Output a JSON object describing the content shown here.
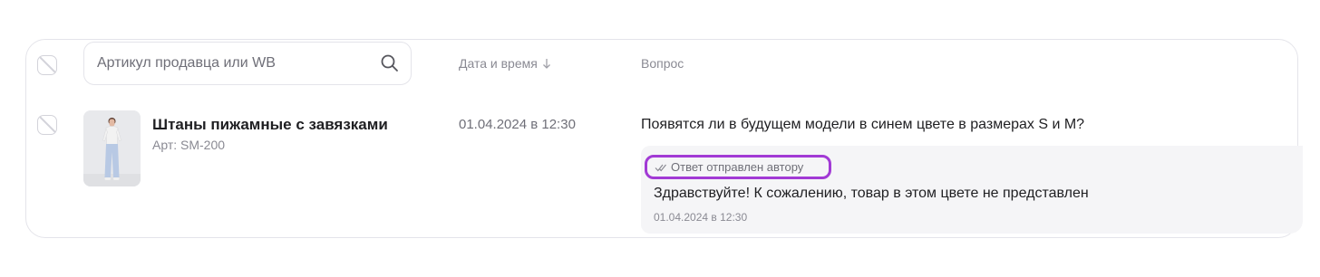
{
  "search": {
    "placeholder": "Артикул продавца или WB"
  },
  "columns": {
    "date_label": "Дата и время",
    "question_label": "Вопрос"
  },
  "rows": [
    {
      "product_name": "Штаны пижамные с завязками",
      "sku": "Арт: SM-200",
      "datetime": "01.04.2024 в 12:30",
      "question": "Появятся ли в будущем модели в синем цвете в размерах  S и M?",
      "answer": {
        "status": "Ответ отправлен автору",
        "text": "Здравствуйте! К сожалению, товар в этом цвете не представлен",
        "datetime": "01.04.2024 в 12:30"
      }
    }
  ],
  "colors": {
    "badge_highlight": "#a23ad5",
    "answer_bg": "#f5f5f7",
    "border": "#e4e4ea"
  }
}
